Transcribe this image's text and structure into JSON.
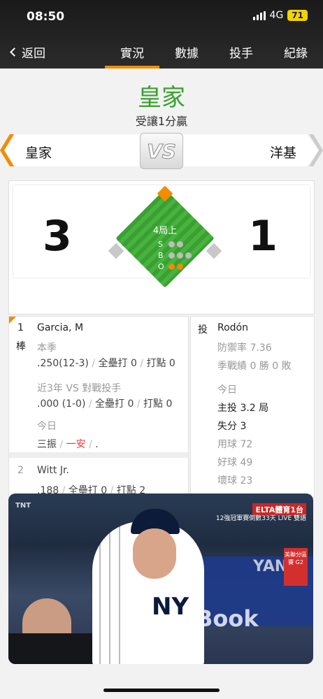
{
  "status": {
    "time": "08:50",
    "network": "4G",
    "battery": "71"
  },
  "nav": {
    "back_label": "返回",
    "tabs": [
      "實況",
      "數據",
      "投手",
      "紀錄"
    ],
    "active_tab": 0
  },
  "game": {
    "title": "皇家",
    "subtitle": "受讓1分贏",
    "away_team": "皇家",
    "home_team": "洋基",
    "vs": "VS",
    "away_score": "3",
    "home_score": "1",
    "inning": "4局上",
    "count": {
      "strikes": 0,
      "balls": 0,
      "outs": 2
    },
    "count_labels": {
      "s": "S",
      "b": "B",
      "o": "O"
    }
  },
  "batters": [
    {
      "order": "1",
      "pos": "棒",
      "name": "Garcia, M",
      "season_label": "本季",
      "season_avg": ".250(12-3)",
      "season_hr": "全壘打 0",
      "season_rbi": "打點 0",
      "vs_label": "近3年 VS 對戰投手",
      "vs_avg": ".000 (1-0)",
      "vs_hr": "全壘打 0",
      "vs_rbi": "打點 0",
      "today_label": "今日",
      "today_1": "三振",
      "today_2": "一安",
      "today_3": "."
    },
    {
      "order": "2",
      "name": "Witt Jr.",
      "season_avg": ".188",
      "season_hr": "全壘打 0",
      "season_rbi": "打點 2"
    }
  ],
  "pitcher": {
    "label": "投",
    "name": "Rodón",
    "era": "防禦率 7.36",
    "record": "季戰績 0 勝 0 敗",
    "today_label": "今日",
    "ip": "主投 3.2 局",
    "runs": "失分 3",
    "pitches": "用球 72",
    "strikes": "好球 49",
    "balls": "壞球 23"
  },
  "video": {
    "channel": "ELTA體育1台",
    "channel_sub": "12強冠軍賽倒數33天 LIVE 雙語",
    "series_tag": "美聯分區賽 G2",
    "broadcaster": "TNT",
    "bg_text_1": "YANK",
    "bg_text_2": "Book",
    "jersey": "NY"
  }
}
